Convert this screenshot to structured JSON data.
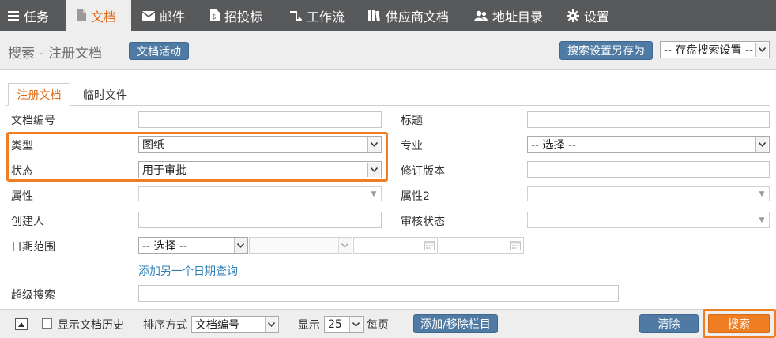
{
  "nav": {
    "tabs": [
      {
        "label": "任务",
        "icon": "menu-icon"
      },
      {
        "label": "文档",
        "icon": "document-icon"
      },
      {
        "label": "邮件",
        "icon": "envelope-icon"
      },
      {
        "label": "招投标",
        "icon": "tender-icon"
      },
      {
        "label": "工作流",
        "icon": "workflow-icon"
      },
      {
        "label": "供应商文档",
        "icon": "books-icon"
      },
      {
        "label": "地址目录",
        "icon": "contacts-icon"
      },
      {
        "label": "设置",
        "icon": "gear-icon"
      }
    ]
  },
  "header": {
    "title": "搜索 - 注册文档",
    "activity_button": "文档活动",
    "save_search_button": "搜索设置另存为",
    "saved_search_select": "-- 存盘搜索设置 --"
  },
  "tabs": [
    "注册文档",
    "临时文件"
  ],
  "form": {
    "doc_number": {
      "label": "文档编号",
      "value": ""
    },
    "title": {
      "label": "标题",
      "value": ""
    },
    "type": {
      "label": "类型",
      "value": "图纸"
    },
    "discipline": {
      "label": "专业",
      "value": "-- 选择 --"
    },
    "status": {
      "label": "状态",
      "value": "用于审批"
    },
    "revision": {
      "label": "修订版本",
      "value": ""
    },
    "attribute": {
      "label": "属性",
      "value": ""
    },
    "attribute2": {
      "label": "属性2",
      "value": ""
    },
    "creator": {
      "label": "创建人",
      "value": ""
    },
    "review_status": {
      "label": "审核状态",
      "value": ""
    },
    "date_range": {
      "label": "日期范围",
      "value": "-- 选择 --",
      "sub_value": ""
    },
    "add_date_query": "添加另一个日期查询",
    "super_search": {
      "label": "超级搜索",
      "value": ""
    }
  },
  "footer": {
    "show_history": "显示文档历史",
    "show_history_checked": false,
    "sort_label": "排序方式",
    "sort_value": "文档编号",
    "display_label": "显示",
    "page_size": "25",
    "per_page": "每页",
    "columns_button": "添加/移除栏目",
    "clear_button": "清除",
    "search_button": "搜索"
  },
  "colors": {
    "accent": "#ef7d22",
    "nav_bg": "#58595b",
    "button_blue": "#4f7aa3",
    "link": "#2f80b5"
  }
}
